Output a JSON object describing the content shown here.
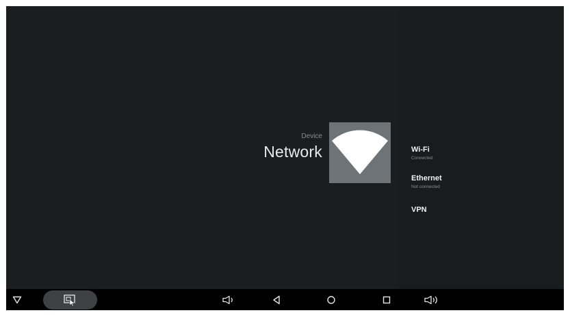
{
  "header": {
    "breadcrumb": "Device",
    "title": "Network",
    "hero_icon": "wifi-icon"
  },
  "menu": {
    "items": [
      {
        "label": "Wi-Fi",
        "status": "Connected"
      },
      {
        "label": "Ethernet",
        "status": "Not connected"
      },
      {
        "label": "VPN",
        "status": ""
      }
    ]
  },
  "nav_bar": {
    "icons": [
      "hide-nav-icon",
      "screenshot-icon",
      "volume-down-icon",
      "back-icon",
      "home-icon",
      "recents-icon",
      "volume-up-icon"
    ]
  },
  "colors": {
    "background": "#1b1e20",
    "panel": "#191c1e",
    "tile": "#6e7377",
    "nav_bar": "#000000",
    "accent_text": "#e8eaeb"
  }
}
